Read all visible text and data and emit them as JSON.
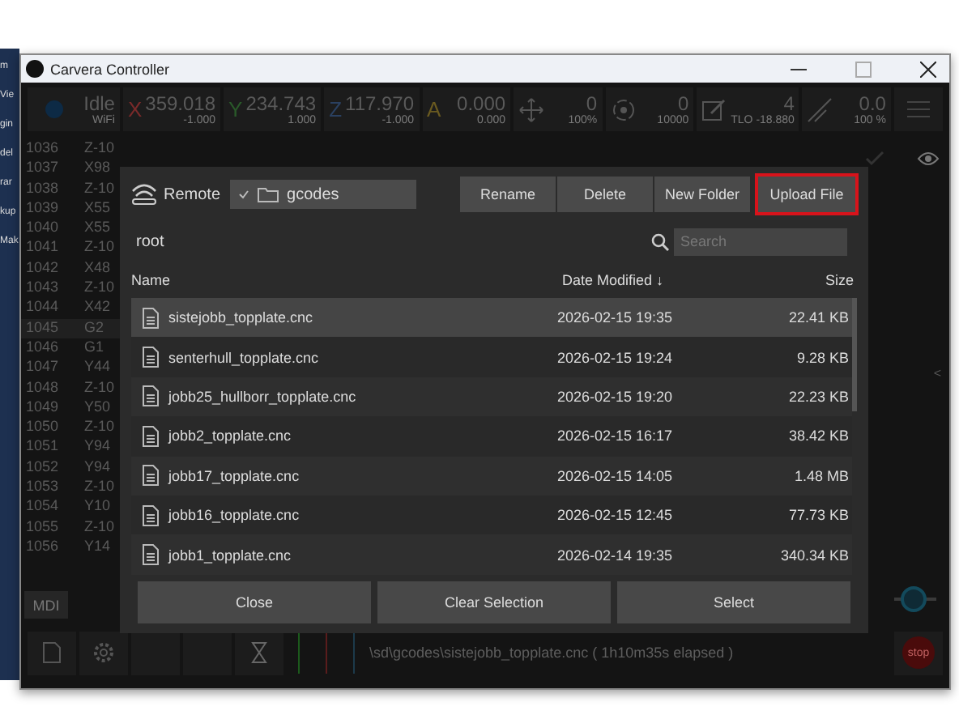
{
  "window": {
    "title": "Carvera Controller"
  },
  "desktop_strip": [
    "m",
    "Vie",
    "gin",
    "del",
    "rar",
    "kup",
    "Mak"
  ],
  "status_bar": [
    {
      "kind": "state",
      "value": "Idle",
      "sub": "WiFi"
    },
    {
      "kind": "axis",
      "axis": "X",
      "value": "359.018",
      "sub": "-1.000",
      "color": "#7a2a2a"
    },
    {
      "kind": "axis",
      "axis": "Y",
      "value": "234.743",
      "sub": "1.000",
      "color": "#2a5a2a"
    },
    {
      "kind": "axis",
      "axis": "Z",
      "value": "117.970",
      "sub": "-1.000",
      "color": "#2a4060"
    },
    {
      "kind": "axis",
      "axis": "A",
      "value": "0.000",
      "sub": "0.000",
      "color": "#6a5a20"
    },
    {
      "kind": "move",
      "value": "0",
      "sub": "100%"
    },
    {
      "kind": "spindle",
      "value": "0",
      "sub": "10000"
    },
    {
      "kind": "tool",
      "value": "4",
      "sub": "TLO -18.880"
    },
    {
      "kind": "laser",
      "value": "0.0",
      "sub": "100 %"
    }
  ],
  "gcode_lines": [
    {
      "number": "1036",
      "code": "Z-10",
      "selected": false
    },
    {
      "number": "1037",
      "code": "X98",
      "selected": false
    },
    {
      "number": "1038",
      "code": "Z-10",
      "selected": false
    },
    {
      "number": "1039",
      "code": "X55",
      "selected": false
    },
    {
      "number": "1040",
      "code": "X55",
      "selected": false
    },
    {
      "number": "1041",
      "code": "Z-10",
      "selected": false
    },
    {
      "number": "1042",
      "code": "X48",
      "selected": false
    },
    {
      "number": "1043",
      "code": "Z-10",
      "selected": false
    },
    {
      "number": "1044",
      "code": "X42",
      "selected": false
    },
    {
      "number": "1045",
      "code": "G2",
      "selected": true
    },
    {
      "number": "1046",
      "code": "G1",
      "selected": false
    },
    {
      "number": "1047",
      "code": "Y44",
      "selected": false
    },
    {
      "number": "1048",
      "code": "Z-10",
      "selected": false
    },
    {
      "number": "1049",
      "code": "Y50",
      "selected": false
    },
    {
      "number": "1050",
      "code": "Z-10",
      "selected": false
    },
    {
      "number": "1051",
      "code": "Y94",
      "selected": false
    },
    {
      "number": "1052",
      "code": "Y94",
      "selected": false
    },
    {
      "number": "1053",
      "code": "Z-10",
      "selected": false
    },
    {
      "number": "1054",
      "code": "Y10",
      "selected": false
    },
    {
      "number": "1055",
      "code": "Z-10",
      "selected": false
    },
    {
      "number": "1056",
      "code": "Y14",
      "selected": false
    }
  ],
  "mdi_button": "MDI",
  "side_collapse": "<",
  "feed_slider": {
    "level": 0.45
  },
  "bottom_bar": {
    "file_path": "\\sd\\gcodes\\sistejobb_topplate.cnc ( 1h10m35s elapsed )",
    "stop": "stop"
  },
  "dialog": {
    "source": "Remote",
    "folder": "gcodes",
    "actions": [
      {
        "label": "Rename",
        "highlighted": false
      },
      {
        "label": "Delete",
        "highlighted": false
      },
      {
        "label": "New Folder",
        "highlighted": false
      },
      {
        "label": "Upload File",
        "highlighted": true
      }
    ],
    "path": "root",
    "search": {
      "placeholder": "Search"
    },
    "columns": [
      "Name",
      "Date Modified ↓",
      "Size"
    ],
    "files": [
      {
        "name": "sistejobb_topplate.cnc",
        "date": "2026-02-15 19:35",
        "size": "22.41 KB",
        "selected": true
      },
      {
        "name": "senterhull_topplate.cnc",
        "date": "2026-02-15 19:24",
        "size": "9.28 KB",
        "selected": false
      },
      {
        "name": "jobb25_hullborr_topplate.cnc",
        "date": "2026-02-15 19:20",
        "size": "22.23 KB",
        "selected": false
      },
      {
        "name": "jobb2_topplate.cnc",
        "date": "2026-02-15 16:17",
        "size": "38.42 KB",
        "selected": false
      },
      {
        "name": "jobb17_topplate.cnc",
        "date": "2026-02-15 14:05",
        "size": "1.48 MB",
        "selected": false
      },
      {
        "name": "jobb16_topplate.cnc",
        "date": "2026-02-15 12:45",
        "size": "77.73 KB",
        "selected": false
      },
      {
        "name": "jobb1_topplate.cnc",
        "date": "2026-02-14 19:35",
        "size": "340.34 KB",
        "selected": false
      }
    ],
    "buttons": [
      "Close",
      "Clear Selection",
      "Select"
    ]
  }
}
